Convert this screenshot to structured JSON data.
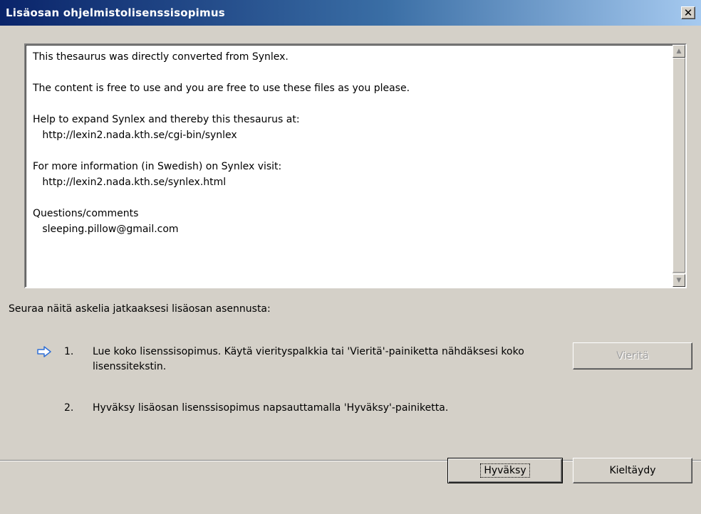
{
  "window": {
    "title": "Lisäosan ohjelmistolisenssisopimus",
    "close_glyph": "✕"
  },
  "license": {
    "text": "This thesaurus was directly converted from Synlex.\n\nThe content is free to use and you are free to use these files as you please.\n\nHelp to expand Synlex and thereby this thesaurus at:\n   http://lexin2.nada.kth.se/cgi-bin/synlex\n\nFor more information (in Swedish) on Synlex visit:\n   http://lexin2.nada.kth.se/synlex.html\n\nQuestions/comments\n   sleeping.pillow@gmail.com"
  },
  "instructions": "Seuraa näitä askelia jatkaaksesi lisäosan asennusta:",
  "steps": [
    {
      "number": "1.",
      "text": "Lue koko lisenssisopimus. Käytä vierityspalkkia tai 'Vieritä'-painiketta nähdäksesi koko lisenssitekstin.",
      "icon": "arrow-right-icon"
    },
    {
      "number": "2.",
      "text": "Hyväksy lisäosan lisenssisopimus napsauttamalla 'Hyväksy'-painiketta."
    }
  ],
  "buttons": {
    "scroll_label": "Vieritä",
    "accept_label": "Hyväksy",
    "decline_label": "Kieltäydy"
  },
  "colors": {
    "title_gradient_start": "#0a246a",
    "title_gradient_end": "#a6caf0",
    "dialog_bg": "#d4d0c8",
    "step_arrow": "#2f6fd6"
  }
}
